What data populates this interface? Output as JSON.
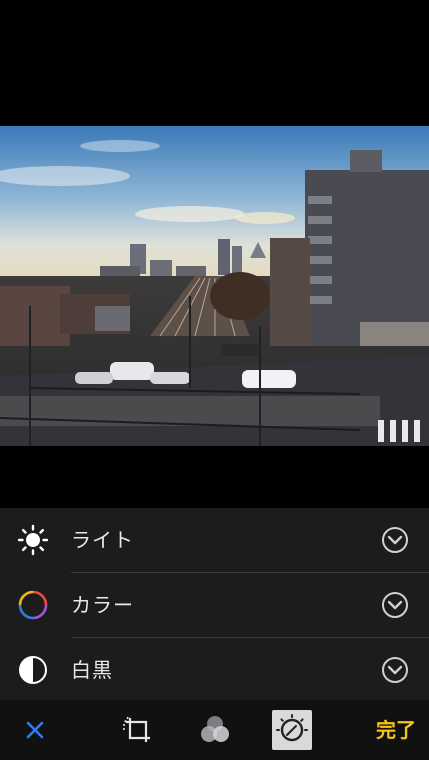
{
  "adjustments": {
    "items": [
      {
        "label": "ライト",
        "icon": "sun-icon"
      },
      {
        "label": "カラー",
        "icon": "color-wheel-icon"
      },
      {
        "label": "白黒",
        "icon": "black-white-icon"
      }
    ]
  },
  "toolbar": {
    "cancel_icon": "close-icon",
    "done_label": "完了",
    "accent_color": "#f5c41a",
    "cancel_color": "#2d7cf6"
  }
}
